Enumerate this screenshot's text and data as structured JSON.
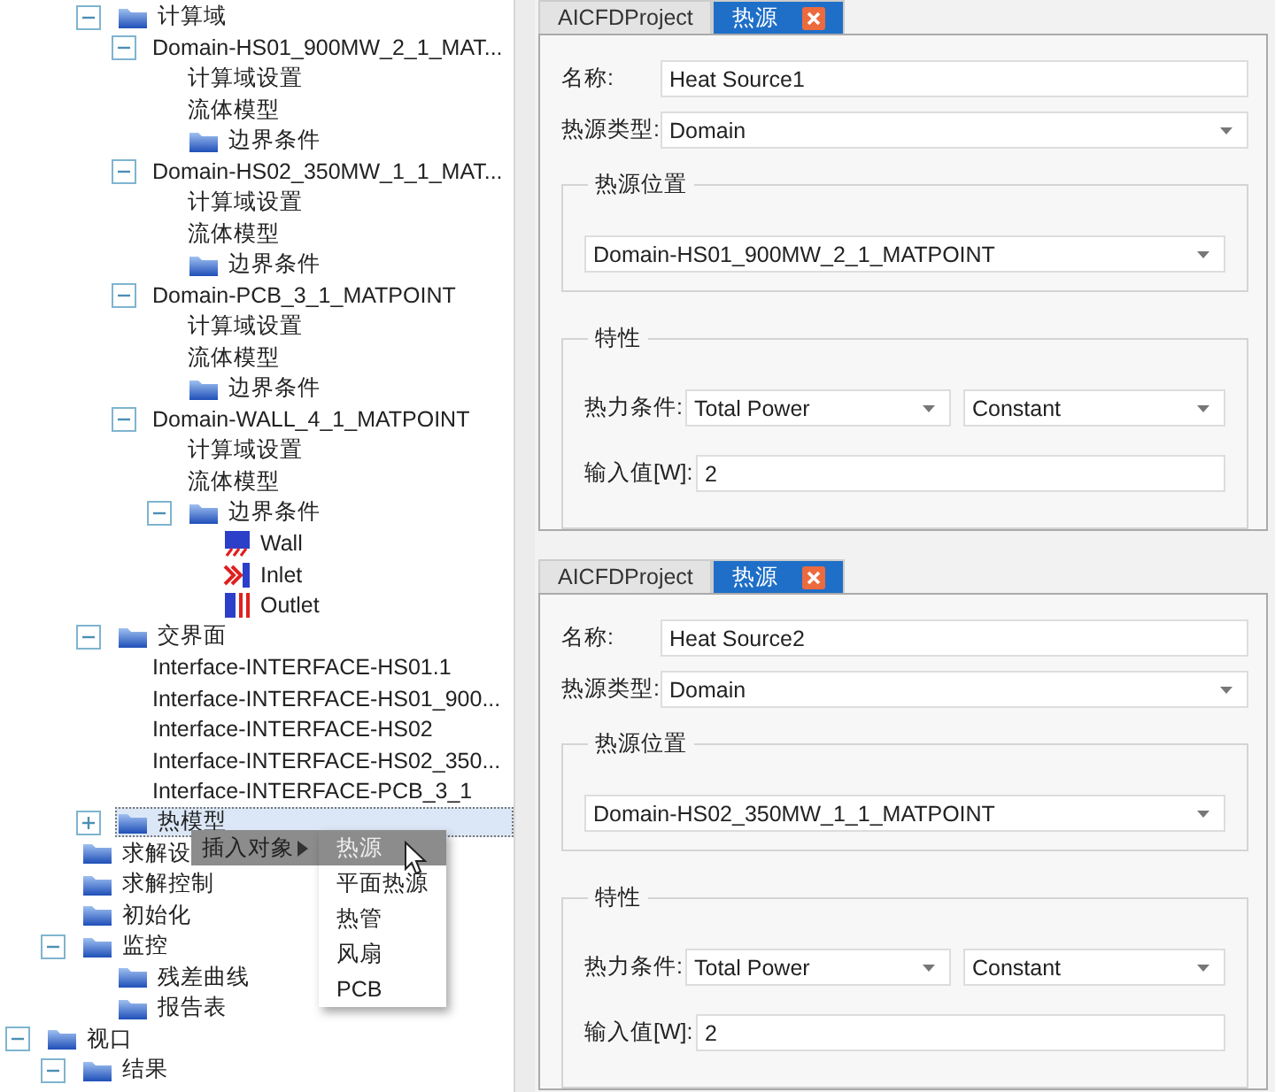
{
  "tree": [
    {
      "children": [
        {
          "children": [
            {
              "label": "计算域",
              "kind": "folder",
              "expanded": true,
              "selected": false,
              "children": [
                {
                  "label": "Domain-HS01_900MW_2_1_MAT...",
                  "expanded": true,
                  "selected": false,
                  "children": [
                    {
                      "label": "计算域设置",
                      "selected": false
                    },
                    {
                      "label": "流体模型",
                      "selected": false
                    },
                    {
                      "label": "边界条件",
                      "kind": "folder",
                      "selected": false
                    }
                  ]
                },
                {
                  "label": "Domain-HS02_350MW_1_1_MAT...",
                  "expanded": true,
                  "selected": false,
                  "children": [
                    {
                      "label": "计算域设置",
                      "selected": false
                    },
                    {
                      "label": "流体模型",
                      "selected": false
                    },
                    {
                      "label": "边界条件",
                      "kind": "folder",
                      "selected": false
                    }
                  ]
                },
                {
                  "label": "Domain-PCB_3_1_MATPOINT",
                  "expanded": true,
                  "selected": false,
                  "children": [
                    {
                      "label": "计算域设置",
                      "selected": false
                    },
                    {
                      "label": "流体模型",
                      "selected": false
                    },
                    {
                      "label": "边界条件",
                      "kind": "folder",
                      "selected": false
                    }
                  ]
                },
                {
                  "label": "Domain-WALL_4_1_MATPOINT",
                  "expanded": true,
                  "selected": false,
                  "children": [
                    {
                      "label": "计算域设置",
                      "selected": false
                    },
                    {
                      "label": "流体模型",
                      "selected": false
                    },
                    {
                      "label": "边界条件",
                      "kind": "folder",
                      "expanded": true,
                      "selected": false,
                      "children": [
                        {
                          "label": "Wall",
                          "kind": "wall",
                          "selected": false
                        },
                        {
                          "label": "Inlet",
                          "kind": "inlet",
                          "selected": false
                        },
                        {
                          "label": "Outlet",
                          "kind": "outlet",
                          "selected": false
                        }
                      ]
                    }
                  ]
                }
              ]
            },
            {
              "label": "交界面",
              "kind": "folder",
              "expanded": true,
              "selected": false,
              "children": [
                {
                  "label": "Interface-INTERFACE-HS01.1",
                  "selected": false
                },
                {
                  "label": "Interface-INTERFACE-HS01_900...",
                  "selected": false
                },
                {
                  "label": "Interface-INTERFACE-HS02",
                  "selected": false
                },
                {
                  "label": "Interface-INTERFACE-HS02_350...",
                  "selected": false
                },
                {
                  "label": "Interface-INTERFACE-PCB_3_1",
                  "selected": false
                }
              ]
            },
            {
              "label": "热模型",
              "kind": "folder",
              "expanded": false,
              "selected": true
            }
          ]
        },
        {
          "label": "求解设",
          "kind": "folder",
          "selected": false
        },
        {
          "label": "求解控制",
          "kind": "folder",
          "selected": false
        },
        {
          "label": "初始化",
          "kind": "folder",
          "selected": false
        },
        {
          "label": "监控",
          "kind": "folder",
          "expanded": true,
          "selected": false,
          "children": [
            {
              "label": "残差曲线",
              "kind": "folder",
              "selected": false
            },
            {
              "label": "报告表",
              "kind": "folder",
              "selected": false
            }
          ]
        }
      ]
    },
    {
      "label": "视口",
      "kind": "folder",
      "expanded": true,
      "selected": false,
      "children": [
        {
          "label": "结果",
          "kind": "folder",
          "expanded": true,
          "selected": false
        }
      ]
    }
  ],
  "context_menu": {
    "items": [
      {
        "label": "插入对象",
        "kind": "submenu",
        "selected": true
      }
    ],
    "submenu": [
      {
        "label": "热源",
        "selected": true
      },
      {
        "label": "平面热源",
        "selected": false
      },
      {
        "label": "热管",
        "selected": false
      },
      {
        "label": "风扇",
        "selected": false
      },
      {
        "label": "PCB",
        "selected": false
      }
    ]
  },
  "panels": [
    {
      "tabs": [
        {
          "label": "AICFDProject",
          "selected": false,
          "closable": false
        },
        {
          "label": "热源",
          "selected": true,
          "closable": true
        }
      ],
      "name_label": "名称:",
      "name": "Heat Source1",
      "type_label": "热源类型:",
      "type": "Domain",
      "location_group": "热源位置",
      "location": "Domain-HS01_900MW_2_1_MATPOINT",
      "props_group": "特性",
      "condition_label": "热力条件:",
      "condition": "Total Power",
      "condition_mode": "Constant",
      "value_label": "输入值[W]:",
      "value": "2"
    },
    {
      "tabs": [
        {
          "label": "AICFDProject",
          "selected": false,
          "closable": false
        },
        {
          "label": "热源",
          "selected": true,
          "closable": true
        }
      ],
      "name_label": "名称:",
      "name": "Heat Source2",
      "type_label": "热源类型:",
      "type": "Domain",
      "location_group": "热源位置",
      "location": "Domain-HS02_350MW_1_1_MATPOINT",
      "props_group": "特性",
      "condition_label": "热力条件:",
      "condition": "Total Power",
      "condition_mode": "Constant",
      "value_label": "输入值[W]:",
      "value": "2"
    }
  ]
}
